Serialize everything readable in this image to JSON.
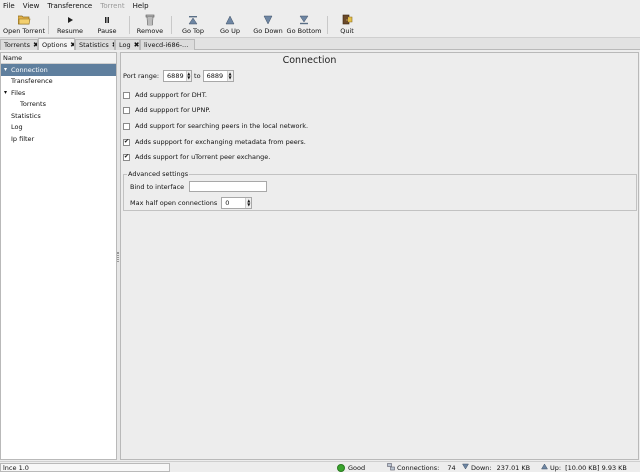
{
  "menubar": {
    "items": [
      {
        "label": "File",
        "enabled": true
      },
      {
        "label": "View",
        "enabled": true
      },
      {
        "label": "Transference",
        "enabled": true
      },
      {
        "label": "Torrent",
        "enabled": false
      },
      {
        "label": "Help",
        "enabled": true
      }
    ]
  },
  "toolbar": {
    "open_torrent": "Open Torrent",
    "resume": "Resume",
    "pause": "Pause",
    "remove": "Remove",
    "go_top": "Go Top",
    "go_up": "Go Up",
    "go_down": "Go Down",
    "go_bottom": "Go Bottom",
    "quit": "Quit"
  },
  "tabs": [
    {
      "label": "Torrents",
      "active": false
    },
    {
      "label": "Options",
      "active": true
    },
    {
      "label": "Statistics",
      "active": false
    },
    {
      "label": "Log",
      "active": false
    },
    {
      "label": "livecd-i686-...",
      "active": false
    }
  ],
  "tree": {
    "header": "Name",
    "items": [
      {
        "label": "Connection",
        "selected": true,
        "expander": "open"
      },
      {
        "label": "Transference"
      },
      {
        "label": "Files",
        "expander": "open"
      },
      {
        "label": "Torrents",
        "child": true
      },
      {
        "label": "Statistics"
      },
      {
        "label": "Log"
      },
      {
        "label": "Ip filter"
      }
    ]
  },
  "connection": {
    "title": "Connection",
    "port_range_label": "Port range:",
    "port_from": "6889",
    "to_label": "to",
    "port_to": "6889",
    "options": [
      {
        "label": "Add suppport for DHT.",
        "checked": false
      },
      {
        "label": "Add suppport for UPNP.",
        "checked": false
      },
      {
        "label": "Add support for searching peers in the local network.",
        "checked": false
      },
      {
        "label": "Adds suppport for exchanging metadata from peers.",
        "checked": true
      },
      {
        "label": "Adds support for uTorrent peer exchange.",
        "checked": true
      }
    ],
    "advanced": {
      "legend": "Advanced settings",
      "bind_label": "Bind to interface",
      "bind_value": "",
      "max_half_label": "Max half open connections",
      "max_half_value": "0"
    }
  },
  "statusbar": {
    "left_text": "lnce 1.0",
    "health": "Good",
    "connections_label": "Connections:",
    "connections_value": "74",
    "down_label": "Down:",
    "down_value": "237.01 KB",
    "up_label": "Up:",
    "up_value": "[10.00 KB] 9.93 KB"
  },
  "colors": {
    "selection": "#5f7f9e",
    "good": "#3aa52e"
  }
}
